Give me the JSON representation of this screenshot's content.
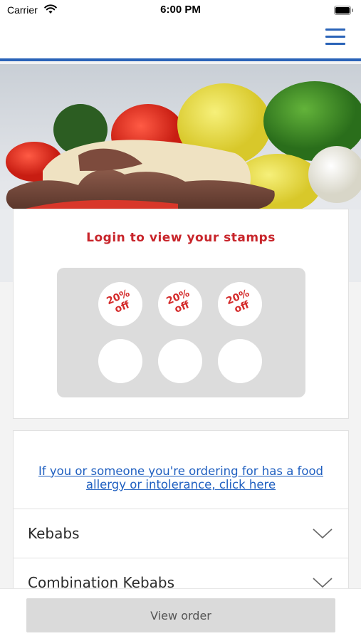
{
  "status_bar": {
    "carrier": "Carrier",
    "time": "6:00 PM",
    "icons": [
      "wifi-icon",
      "battery-icon"
    ]
  },
  "navbar": {
    "menu_icon": "hamburger-menu-icon",
    "accent_color": "#2a63b8"
  },
  "hero": {
    "image": "kebab-with-vegetables-photo"
  },
  "stamps": {
    "title": "Login to view your stamps",
    "title_color": "#c8252b",
    "items": [
      {
        "line1": "20%",
        "line2": "off"
      },
      {
        "line1": "20%",
        "line2": "off"
      },
      {
        "line1": "20%",
        "line2": "off"
      },
      {
        "line1": "",
        "line2": ""
      },
      {
        "line1": "",
        "line2": ""
      },
      {
        "line1": "",
        "line2": ""
      }
    ]
  },
  "menu": {
    "allergy_line1": "If you or someone you're ordering for has a food",
    "allergy_line2": "allergy or intolerance, click here",
    "categories": [
      {
        "label": "Kebabs"
      },
      {
        "label": "Combination Kebabs"
      }
    ],
    "chevron_icon": "chevron-down-icon"
  },
  "bottom": {
    "view_order_label": "View order"
  }
}
